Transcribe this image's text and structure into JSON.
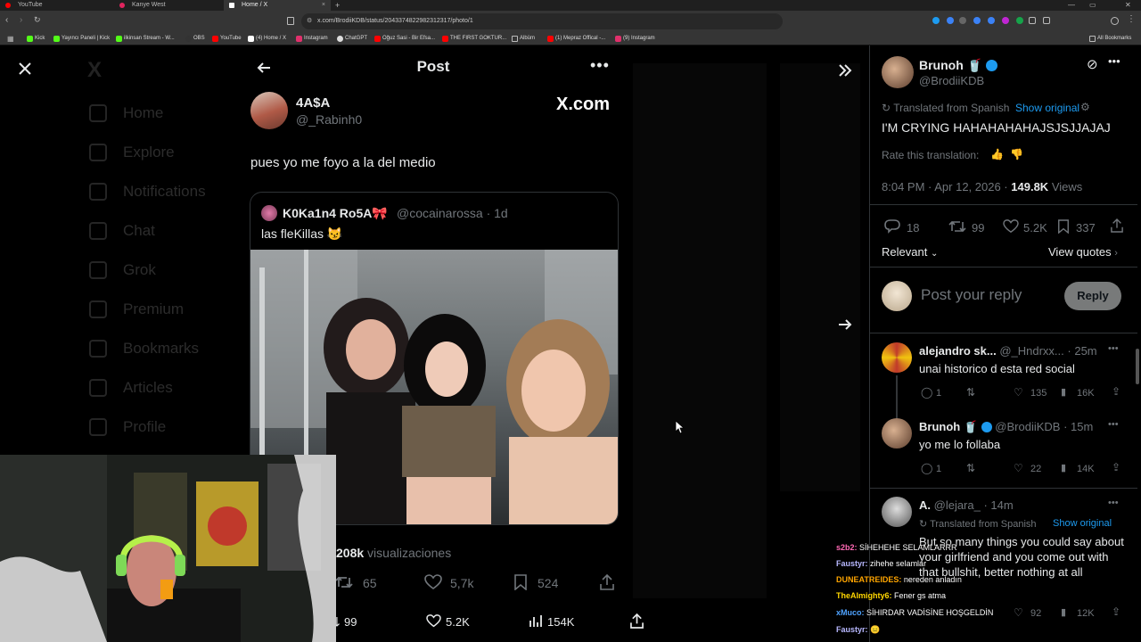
{
  "browser": {
    "tabs": [
      {
        "label": "YouTube",
        "color": "#ff0000"
      },
      {
        "label": "Kanye West",
        "color": "#e0245e"
      },
      {
        "label": "Home / X",
        "color": "#ffffff"
      }
    ],
    "url": "x.com/BrodiiKDB/status/2043374822982312317/photo/1",
    "bookmarks": [
      "Kick",
      "Yayıncı Paneli | Kick",
      "ilkinsan Stream - W...",
      "OBS",
      "YouTube",
      "(4) Home / X",
      "Instagram",
      "ChatGPT",
      "Oğuz Sasi - Bir Efsa...",
      "THE FIRST GOKTUR...",
      "Albüm",
      "(1) Mepraz Offical -...",
      "(9) Instagram"
    ],
    "all_bookmarks": "All Bookmarks"
  },
  "background_nav": [
    "Home",
    "Explore",
    "Notifications",
    "Chat",
    "Grok",
    "Premium",
    "Bookmarks",
    "Articles",
    "Profile"
  ],
  "post": {
    "header_title": "Post",
    "author_name": "4A$A",
    "author_handle": "@_Rabinh0",
    "watermark": "X.com",
    "text": "pues yo me foyo a la del medio",
    "quote": {
      "name": "K0Ka1n4 Ro5A🎀",
      "handle": "@cocainarossa",
      "time": "· 1d",
      "text": "las fleKillas 😼"
    },
    "views_value": "208k",
    "views_label": "visualizaciones",
    "actions": {
      "retweets": "65",
      "likes": "5,7k",
      "bookmarks": "524"
    },
    "bottom_actions": {
      "retweets": "99",
      "likes": "5.2K",
      "views": "154K"
    }
  },
  "sidebar": {
    "author_name": "Brunoh",
    "author_emoji": "🥤",
    "author_handle": "@BrodiiKDB",
    "translated_note": "Translated from Spanish",
    "show_original": "Show original",
    "tweet_text": "I'M CRYING HAHAHAHAHAJSJSJJAJAJ",
    "rate_translation": "Rate this translation:",
    "timestamp": "8:04 PM · Apr 12, 2026 ·",
    "views_count": "149.8K",
    "views_label": "Views",
    "stats": {
      "replies": "18",
      "retweets": "99",
      "likes": "5.2K",
      "bookmarks": "337"
    },
    "sort_label": "Relevant",
    "view_quotes": "View quotes",
    "reply_placeholder": "Post your reply",
    "reply_button": "Reply",
    "replies": [
      {
        "name": "alejandro sk...",
        "handle": "@_Hndrxx...",
        "time": "· 25m",
        "text": "unai historico d esta red social",
        "stats": {
          "replies": "1",
          "likes": "135",
          "views": "16K"
        }
      },
      {
        "name": "Brunoh",
        "emoji": "🥤",
        "handle": "@BrodiiKDB",
        "time": "· 15m",
        "text": "yo me lo follaba",
        "stats": {
          "replies": "1",
          "likes": "22",
          "views": "14K"
        }
      },
      {
        "name": "A.",
        "handle": "@lejara_",
        "time": "· 14m",
        "translated_note": "Translated from Spanish",
        "show_original": "Show original",
        "text": "But so many things you could say about your girlfriend and you come out with that bullshit, better nothing at all",
        "stats": {
          "likes": "92",
          "views": "12K"
        }
      }
    ]
  },
  "chat": [
    {
      "user": "s2b2:",
      "color": "#ff69b4",
      "msg": "SİHEHEHE SELAMLARRR"
    },
    {
      "user": "Faustyr:",
      "color": "#b8b8ff",
      "msg": "zihehe selamlar"
    },
    {
      "user": "DUNEATREIDES:",
      "color": "#ffa500",
      "msg": "nereden anladın"
    },
    {
      "user": "TheAlmighty6:",
      "color": "#ffd700",
      "msg": "Fener gs atma"
    },
    {
      "user": "xMuco:",
      "color": "#4fa3ff",
      "msg": "SİHIRDAR VADİSİNE HOŞGELDİN"
    },
    {
      "user": "Faustyr:",
      "color": "#b8b8ff",
      "msg": "😑"
    }
  ],
  "colors": {
    "accent": "#1d9bf0",
    "muted": "#71767b",
    "text": "#e7e9ea"
  }
}
